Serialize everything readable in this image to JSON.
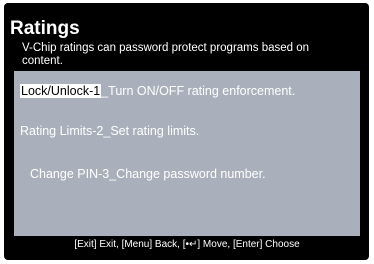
{
  "header": {
    "title": "Ratings",
    "subtitle": "V-Chip ratings can password protect programs based on content."
  },
  "menu": {
    "items": [
      {
        "key": "Lock/Unlock-1",
        "desc": "_Turn ON/OFF rating enforcement.",
        "selected": true
      },
      {
        "key": "Rating Limits-2",
        "desc": "_Set rating limits.",
        "selected": false
      },
      {
        "key": "Change PIN-3",
        "desc": "_Change password number.",
        "selected": false
      }
    ]
  },
  "footer": {
    "hint": "[Exit] Exit, [Menu] Back, [•↵] Move, [Enter] Choose"
  },
  "colors": {
    "background": "#000000",
    "panel": "#a9b0bb",
    "text": "#ffffff",
    "highlight_bg": "#ffffff",
    "highlight_text": "#000000"
  }
}
